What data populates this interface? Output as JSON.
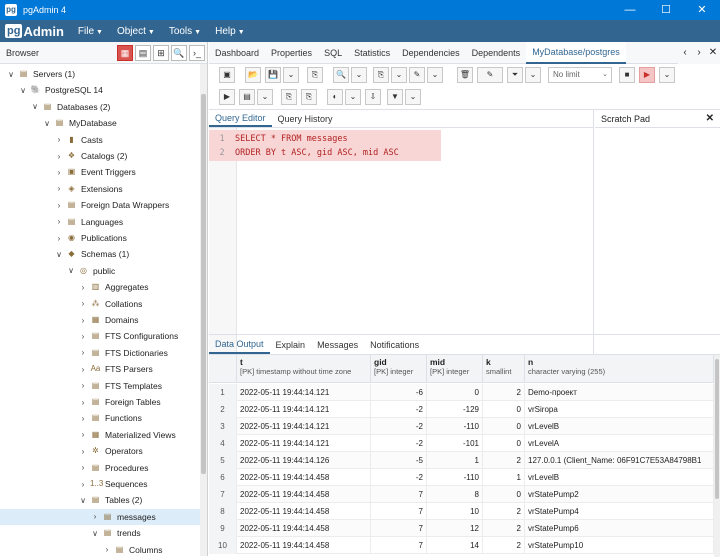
{
  "window": {
    "title": "pgAdmin 4",
    "controls": [
      "—",
      "☐",
      "✕"
    ]
  },
  "menu": {
    "logo_pg": "pg",
    "logo_rest": "Admin",
    "items": [
      "File",
      "Object",
      "Tools",
      "Help"
    ]
  },
  "browser": {
    "label": "Browser",
    "tools": [
      "▦",
      "▤",
      "⊞",
      "🔍",
      "›_"
    ],
    "tree": [
      {
        "toggle": "∨",
        "icon": "▤",
        "label": "Servers (1)"
      },
      {
        "toggle": "∨",
        "icon": "🐘",
        "label": "PostgreSQL 14"
      },
      {
        "toggle": "∨",
        "icon": "▤",
        "label": "Databases (2)"
      },
      {
        "toggle": "∨",
        "icon": "▤",
        "label": "MyDatabase"
      },
      {
        "toggle": "›",
        "icon": "▮",
        "label": "Casts"
      },
      {
        "toggle": "›",
        "icon": "❖",
        "label": "Catalogs (2)"
      },
      {
        "toggle": "›",
        "icon": "▣",
        "label": "Event Triggers"
      },
      {
        "toggle": "›",
        "icon": "◈",
        "label": "Extensions"
      },
      {
        "toggle": "›",
        "icon": "▤",
        "label": "Foreign Data Wrappers"
      },
      {
        "toggle": "›",
        "icon": "▤",
        "label": "Languages"
      },
      {
        "toggle": "›",
        "icon": "◉",
        "label": "Publications"
      },
      {
        "toggle": "∨",
        "icon": "◆",
        "label": "Schemas (1)"
      },
      {
        "toggle": "∨",
        "icon": "◎",
        "label": "public"
      },
      {
        "toggle": "›",
        "icon": "▥",
        "label": "Aggregates"
      },
      {
        "toggle": "›",
        "icon": "⁂",
        "label": "Collations"
      },
      {
        "toggle": "›",
        "icon": "▦",
        "label": "Domains"
      },
      {
        "toggle": "›",
        "icon": "▤",
        "label": "FTS Configurations"
      },
      {
        "toggle": "›",
        "icon": "▤",
        "label": "FTS Dictionaries"
      },
      {
        "toggle": "›",
        "icon": "Aa",
        "label": "FTS Parsers"
      },
      {
        "toggle": "›",
        "icon": "▤",
        "label": "FTS Templates"
      },
      {
        "toggle": "›",
        "icon": "▤",
        "label": "Foreign Tables"
      },
      {
        "toggle": "›",
        "icon": "▤",
        "label": "Functions"
      },
      {
        "toggle": "›",
        "icon": "▦",
        "label": "Materialized Views"
      },
      {
        "toggle": "›",
        "icon": "✲",
        "label": "Operators"
      },
      {
        "toggle": "›",
        "icon": "▤",
        "label": "Procedures"
      },
      {
        "toggle": "›",
        "icon": "1..3",
        "label": "Sequences"
      },
      {
        "toggle": "∨",
        "icon": "▤",
        "label": "Tables (2)"
      },
      {
        "toggle": "›",
        "icon": "▤",
        "label": "messages"
      },
      {
        "toggle": "∨",
        "icon": "▤",
        "label": "trends"
      },
      {
        "toggle": "›",
        "icon": "▤",
        "label": "Columns"
      }
    ]
  },
  "tabs": {
    "items": [
      "Dashboard",
      "Properties",
      "SQL",
      "Statistics",
      "Dependencies",
      "Dependents",
      "MyDatabase/postgres"
    ],
    "nav": [
      "‹",
      "›",
      "✕"
    ]
  },
  "toolbar": {
    "row1": [
      "▣",
      "📂",
      "💾",
      "⌄",
      "⎘",
      "🔍",
      "⌄",
      "⎘",
      "⌄",
      "✎",
      "⌄",
      "🗑",
      "✎",
      "⌄",
      "⏷",
      "⌄"
    ],
    "limit": "No limit",
    "row2": [
      "■",
      "▶",
      "⌄",
      "▶",
      "▤",
      "⌄",
      "⎘",
      "⎘",
      "◐",
      "⌄",
      "⇩",
      "▼",
      "⌄"
    ]
  },
  "editor": {
    "tabs": [
      "Query Editor",
      "Query History"
    ],
    "lines": [
      {
        "no": "1",
        "text": "SELECT * FROM messages"
      },
      {
        "no": "2",
        "text": "ORDER BY t ASC, gid ASC, mid ASC"
      }
    ]
  },
  "scratch": {
    "label": "Scratch Pad",
    "close": "✕"
  },
  "output": {
    "tabs": [
      "Data Output",
      "Explain",
      "Messages",
      "Notifications"
    ],
    "columns": [
      {
        "name": "t",
        "type": "[PK] timestamp without time zone"
      },
      {
        "name": "gid",
        "type": "[PK] integer"
      },
      {
        "name": "mid",
        "type": "[PK] integer"
      },
      {
        "name": "k",
        "type": "smallint"
      },
      {
        "name": "n",
        "type": "character varying (255)"
      }
    ],
    "rows": [
      {
        "no": "1",
        "t": "2022-05-11 19:44:14.121",
        "gid": "-6",
        "mid": "0",
        "k": "2",
        "n": "Demo-проект"
      },
      {
        "no": "2",
        "t": "2022-05-11 19:44:14.121",
        "gid": "-2",
        "mid": "-129",
        "k": "0",
        "n": "vrSiropa"
      },
      {
        "no": "3",
        "t": "2022-05-11 19:44:14.121",
        "gid": "-2",
        "mid": "-110",
        "k": "0",
        "n": "vrLevelB"
      },
      {
        "no": "4",
        "t": "2022-05-11 19:44:14.121",
        "gid": "-2",
        "mid": "-101",
        "k": "0",
        "n": "vrLevelA"
      },
      {
        "no": "5",
        "t": "2022-05-11 19:44:14.126",
        "gid": "-5",
        "mid": "1",
        "k": "2",
        "n": "127.0.0.1 (Client_Name: 06F91C7E53A84798B1"
      },
      {
        "no": "6",
        "t": "2022-05-11 19:44:14.458",
        "gid": "-2",
        "mid": "-110",
        "k": "1",
        "n": "vrLevelB"
      },
      {
        "no": "7",
        "t": "2022-05-11 19:44:14.458",
        "gid": "7",
        "mid": "8",
        "k": "0",
        "n": "vrStatePump2"
      },
      {
        "no": "8",
        "t": "2022-05-11 19:44:14.458",
        "gid": "7",
        "mid": "10",
        "k": "2",
        "n": "vrStatePump4"
      },
      {
        "no": "9",
        "t": "2022-05-11 19:44:14.458",
        "gid": "7",
        "mid": "12",
        "k": "2",
        "n": "vrStatePump6"
      },
      {
        "no": "10",
        "t": "2022-05-11 19:44:14.458",
        "gid": "7",
        "mid": "14",
        "k": "2",
        "n": "vrStatePump10"
      }
    ]
  }
}
